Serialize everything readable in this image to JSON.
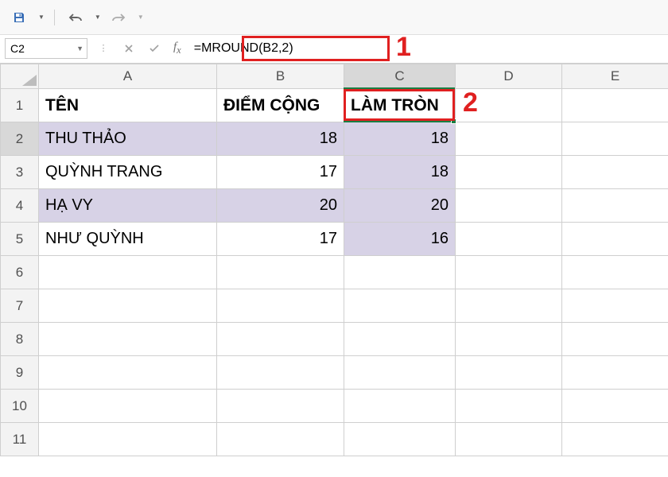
{
  "qat": {
    "save": "save-icon",
    "undo": "undo-icon",
    "redo": "redo-icon"
  },
  "formulaBar": {
    "nameBox": "C2",
    "formula": "=MROUND(B2,2)"
  },
  "callouts": {
    "one": "1",
    "two": "2"
  },
  "columns": [
    "A",
    "B",
    "C",
    "D",
    "E"
  ],
  "rowNumbers": [
    "1",
    "2",
    "3",
    "4",
    "5",
    "6",
    "7",
    "8",
    "9",
    "10",
    "11"
  ],
  "headers": {
    "A": "TÊN",
    "B": "ĐIỂM CỘNG",
    "C": "LÀM TRÒN"
  },
  "rows": [
    {
      "name": "THU THẢO",
      "score": "18",
      "round": "18"
    },
    {
      "name": "QUỲNH TRANG",
      "score": "17",
      "round": "18"
    },
    {
      "name": "HẠ VY",
      "score": "20",
      "round": "20"
    },
    {
      "name": "NHƯ QUỲNH",
      "score": "17",
      "round": "16"
    }
  ],
  "chart_data": {
    "type": "table",
    "title": "",
    "columns": [
      "TÊN",
      "ĐIỂM CỘNG",
      "LÀM TRÒN"
    ],
    "data": [
      [
        "THU THẢO",
        18,
        18
      ],
      [
        "QUỲNH TRANG",
        17,
        18
      ],
      [
        "HẠ VY",
        20,
        20
      ],
      [
        "NHƯ QUỲNH",
        17,
        16
      ]
    ]
  }
}
